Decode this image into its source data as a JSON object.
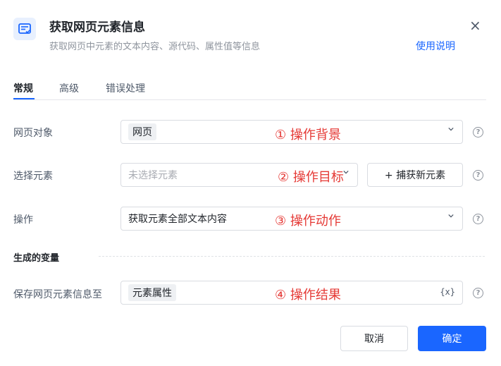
{
  "header": {
    "title": "获取网页元素信息",
    "subtitle": "获取网页中元素的文本内容、源代码、属性值等信息",
    "help_link": "使用说明",
    "close_glyph": "×"
  },
  "tabs": [
    {
      "label": "常规",
      "active": true
    },
    {
      "label": "高级",
      "active": false
    },
    {
      "label": "错误处理",
      "active": false
    }
  ],
  "form": {
    "web_object": {
      "label": "网页对象",
      "value": "网页",
      "annotation": "① 操作背景"
    },
    "select_element": {
      "label": "选择元素",
      "placeholder": "未选择元素",
      "annotation": "② 操作目标",
      "capture_button": "+ 捕获新元素"
    },
    "operation": {
      "label": "操作",
      "value": "获取元素全部文本内容",
      "annotation": "③ 操作动作"
    },
    "section_title": "生成的变量",
    "save_to": {
      "label": "保存网页元素信息至",
      "value": "元素属性",
      "annotation": "④ 操作结果",
      "variable_icon": "{x}"
    }
  },
  "footer": {
    "cancel": "取消",
    "confirm": "确定"
  },
  "help_glyph": "?",
  "colors": {
    "accent": "#1a66ff",
    "annotation": "#e53935"
  }
}
